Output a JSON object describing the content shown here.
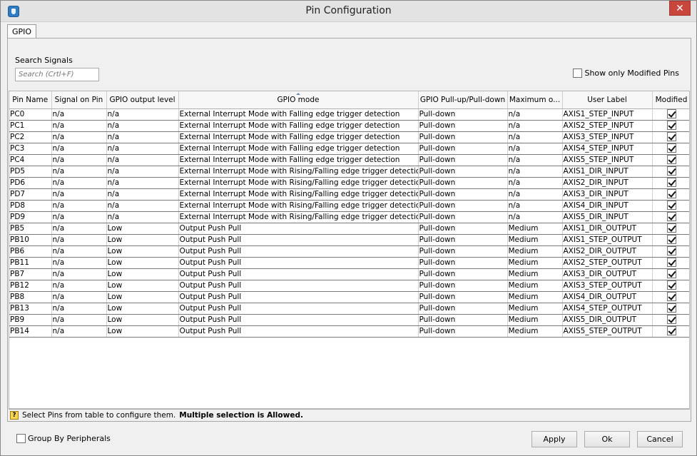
{
  "window": {
    "title": "Pin Configuration",
    "close_glyph": "✕"
  },
  "tabs": [
    {
      "label": "GPIO"
    }
  ],
  "search": {
    "label": "Search Signals",
    "placeholder": "Search (Crtl+F)"
  },
  "show_modified": {
    "label": "Show only Modified Pins",
    "checked": false
  },
  "table": {
    "columns": [
      "Pin Name",
      "Signal on Pin",
      "GPIO output level",
      "GPIO mode",
      "GPIO Pull-up/Pull-down",
      "Maximum o...",
      "User Label",
      "Modified"
    ],
    "rows": [
      [
        "PC0",
        "n/a",
        "n/a",
        "External Interrupt Mode with Falling edge trigger detection",
        "Pull-down",
        "n/a",
        "AXIS1_STEP_INPUT"
      ],
      [
        "PC1",
        "n/a",
        "n/a",
        "External Interrupt Mode with Falling edge trigger detection",
        "Pull-down",
        "n/a",
        "AXIS2_STEP_INPUT"
      ],
      [
        "PC2",
        "n/a",
        "n/a",
        "External Interrupt Mode with Falling edge trigger detection",
        "Pull-down",
        "n/a",
        "AXIS3_STEP_INPUT"
      ],
      [
        "PC3",
        "n/a",
        "n/a",
        "External Interrupt Mode with Falling edge trigger detection",
        "Pull-down",
        "n/a",
        "AXIS4_STEP_INPUT"
      ],
      [
        "PC4",
        "n/a",
        "n/a",
        "External Interrupt Mode with Falling edge trigger detection",
        "Pull-down",
        "n/a",
        "AXIS5_STEP_INPUT"
      ],
      [
        "PD5",
        "n/a",
        "n/a",
        "External Interrupt Mode with Rising/Falling edge trigger detection",
        "Pull-down",
        "n/a",
        "AXIS1_DIR_INPUT"
      ],
      [
        "PD6",
        "n/a",
        "n/a",
        "External Interrupt Mode with Rising/Falling edge trigger detection",
        "Pull-down",
        "n/a",
        "AXIS2_DIR_INPUT"
      ],
      [
        "PD7",
        "n/a",
        "n/a",
        "External Interrupt Mode with Rising/Falling edge trigger detection",
        "Pull-down",
        "n/a",
        "AXIS3_DIR_INPUT"
      ],
      [
        "PD8",
        "n/a",
        "n/a",
        "External Interrupt Mode with Rising/Falling edge trigger detection",
        "Pull-down",
        "n/a",
        "AXIS4_DIR_INPUT"
      ],
      [
        "PD9",
        "n/a",
        "n/a",
        "External Interrupt Mode with Rising/Falling edge trigger detection",
        "Pull-down",
        "n/a",
        "AXIS5_DIR_INPUT"
      ],
      [
        "PB5",
        "n/a",
        "Low",
        "Output Push Pull",
        "Pull-down",
        "Medium",
        "AXIS1_DIR_OUTPUT"
      ],
      [
        "PB10",
        "n/a",
        "Low",
        "Output Push Pull",
        "Pull-down",
        "Medium",
        "AXIS1_STEP_OUTPUT"
      ],
      [
        "PB6",
        "n/a",
        "Low",
        "Output Push Pull",
        "Pull-down",
        "Medium",
        "AXIS2_DIR_OUTPUT"
      ],
      [
        "PB11",
        "n/a",
        "Low",
        "Output Push Pull",
        "Pull-down",
        "Medium",
        "AXIS2_STEP_OUTPUT"
      ],
      [
        "PB7",
        "n/a",
        "Low",
        "Output Push Pull",
        "Pull-down",
        "Medium",
        "AXIS3_DIR_OUTPUT"
      ],
      [
        "PB12",
        "n/a",
        "Low",
        "Output Push Pull",
        "Pull-down",
        "Medium",
        "AXIS3_STEP_OUTPUT"
      ],
      [
        "PB8",
        "n/a",
        "Low",
        "Output Push Pull",
        "Pull-down",
        "Medium",
        "AXIS4_DIR_OUTPUT"
      ],
      [
        "PB13",
        "n/a",
        "Low",
        "Output Push Pull",
        "Pull-down",
        "Medium",
        "AXIS4_STEP_OUTPUT"
      ],
      [
        "PB9",
        "n/a",
        "Low",
        "Output Push Pull",
        "Pull-down",
        "Medium",
        "AXIS5_DIR_OUTPUT"
      ],
      [
        "PB14",
        "n/a",
        "Low",
        "Output Push Pull",
        "Pull-down",
        "Medium",
        "AXIS5_STEP_OUTPUT"
      ]
    ],
    "modified": [
      true,
      true,
      true,
      true,
      true,
      true,
      true,
      true,
      true,
      true,
      true,
      true,
      true,
      true,
      true,
      true,
      true,
      true,
      true,
      true
    ]
  },
  "hint": {
    "text": "Select Pins from table to configure them.",
    "bold": "Multiple selection is Allowed."
  },
  "group_by": {
    "label": "Group By Peripherals",
    "checked": false
  },
  "buttons": {
    "apply": "Apply",
    "ok": "Ok",
    "cancel": "Cancel"
  },
  "colors": {
    "close": "#c9463d",
    "app_icon": "#2f7bc4",
    "help_icon": "#f8d64e"
  }
}
